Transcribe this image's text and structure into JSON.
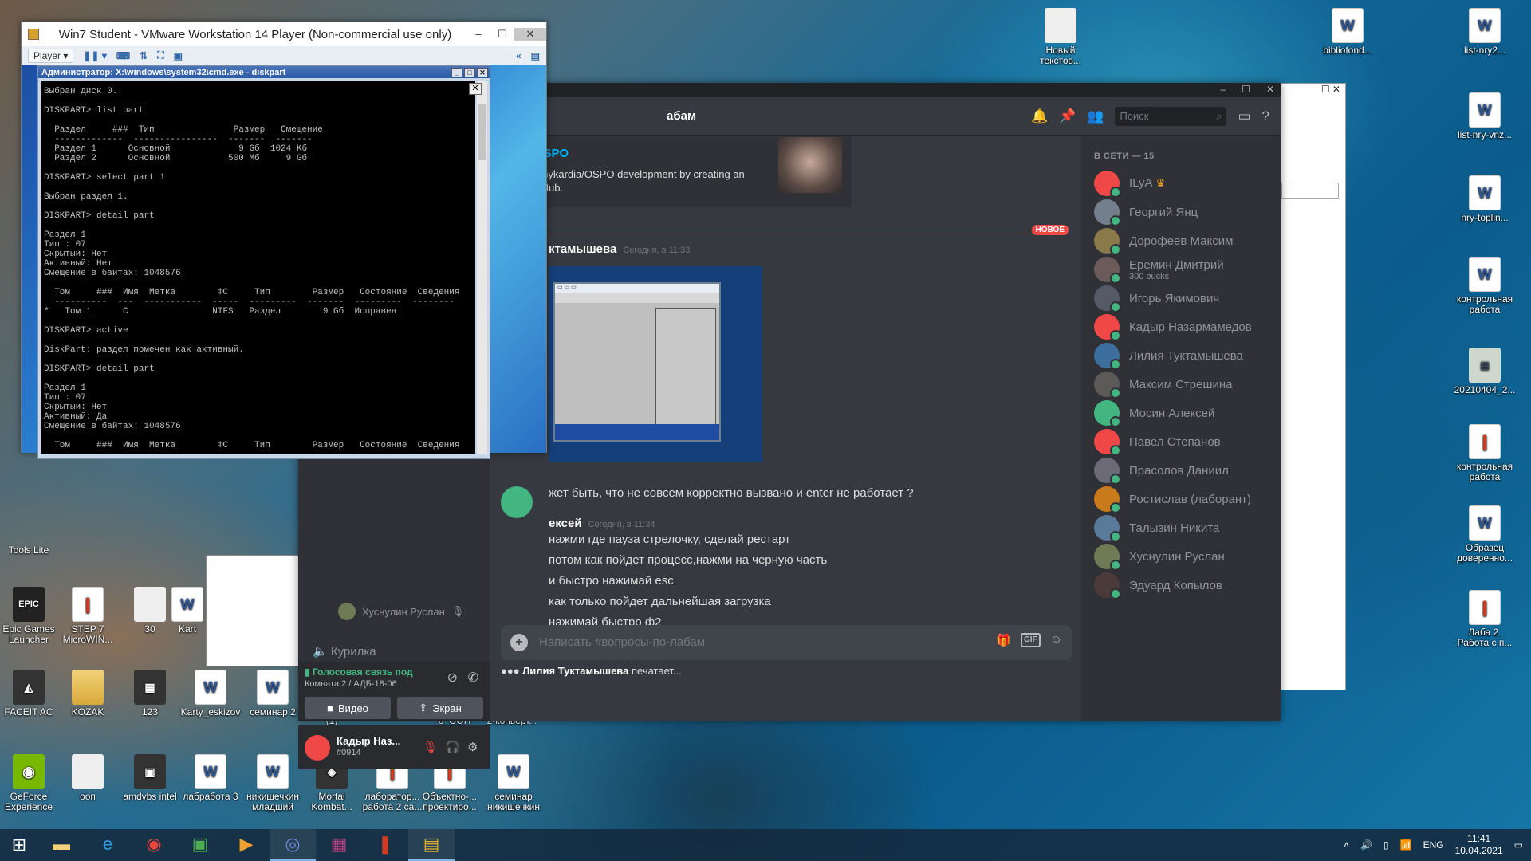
{
  "desktop_icons": [
    {
      "label": "bibliofond..."
    },
    {
      "label": "list-nry2..."
    },
    {
      "label": "Новый текстов..."
    },
    {
      "label": "list-nry-vnz..."
    },
    {
      "label": "nry-toplin..."
    },
    {
      "label": "контрольная работа"
    },
    {
      "label": "20210404_2..."
    },
    {
      "label": "контрольная работа"
    },
    {
      "label": "Образец доверенно..."
    },
    {
      "label": "Лаба 2. Работа с п..."
    },
    {
      "label": "Epic Games Launcher"
    },
    {
      "label": "STEP 7 MicroWIN..."
    },
    {
      "label": "30"
    },
    {
      "label": "Kart"
    },
    {
      "label": "FACEIT AC"
    },
    {
      "label": "KOZAK"
    },
    {
      "label": "123"
    },
    {
      "label": "Karty_eskizov"
    },
    {
      "label": "семинар 2"
    },
    {
      "label": "(1)"
    },
    {
      "label": "6_ООП"
    },
    {
      "label": "2-конверт..."
    },
    {
      "label": "GeForce Experience"
    },
    {
      "label": "ooп"
    },
    {
      "label": "amdvbs intel"
    },
    {
      "label": "лабработа 3"
    },
    {
      "label": "никишечкин младший"
    },
    {
      "label": "Mortal Kombat..."
    },
    {
      "label": "лаборатор... работа 2 са..."
    },
    {
      "label": "Объектно-... проектиро..."
    },
    {
      "label": "семинар никишечкин"
    },
    {
      "label": "Tools Lite"
    }
  ],
  "vmware": {
    "title": "Win7 Student - VMware Workstation 14 Player (Non-commercial use only)",
    "player_menu": "Player ▾",
    "controls": {
      "min": "–",
      "max": "☐",
      "close": "✕"
    }
  },
  "cmd": {
    "title": "Администратор: X:\\windows\\system32\\cmd.exe - diskpart",
    "lines": [
      "Выбран диск 0.",
      "",
      "DISKPART> list part",
      "",
      "  Раздел     ###  Тип               Размер   Смещение",
      "  -------------  ----------------  -------  -------",
      "  Раздел 1      Основной             9 Gб  1024 Kб",
      "  Раздел 2      Основной           500 Mб     9 Gб",
      "",
      "DISKPART> select part 1",
      "",
      "Выбран раздел 1.",
      "",
      "DISKPART> detail part",
      "",
      "Раздел 1",
      "Тип : 07",
      "Скрытый: Нет",
      "Активный: Нет",
      "Смещение в байтах: 1048576",
      "",
      "  Том     ###  Имя  Метка        ФС     Тип        Размер   Состояние  Сведения",
      "  ----------  ---  -----------  -----  ---------  -------  ---------  --------",
      "*   Том 1      C                NTFS   Раздел        9 Gб  Исправен",
      "",
      "DISKPART> active",
      "",
      "DiskPart: раздел помечен как активный.",
      "",
      "DISKPART> detail part",
      "",
      "Раздел 1",
      "Тип : 07",
      "Скрытый: Нет",
      "Активный: Да",
      "Смещение в байтах: 1048576",
      "",
      "  Том     ###  Имя  Метка        ФС     Тип        Размер   Состояние  Сведения",
      "  ----------  ---  -----------  -----  ---------  -------  ---------  --------",
      "*   Том 1      C                NTFS   Раздел        9 Gб  Исправен",
      "",
      "DISKPART>"
    ]
  },
  "discord": {
    "channel_name": "абам",
    "search_placeholder": "Поиск",
    "embed": {
      "link": "dia/OSPO",
      "desc": "e to tahykardia/OSPO development by creating an on GitHub."
    },
    "new_tag": "НОВОЕ",
    "msg1": {
      "author": "ктамышева",
      "time": "Сегодня, в 11:33"
    },
    "msg1_text": "жет быть, что не совсем корректно вызвано и enter не работает ?",
    "msg2": {
      "author": "ексей",
      "time": "Сегодня, в 11:34"
    },
    "msg2_lines": [
      "нажми где пауза стрелочку, сделай рестарт",
      "потом как пойдет процесс,нажми на черную часть",
      "и быстро нажимай esc",
      "как только пойдет дальнейшая загрузка",
      "нажимай быстро ф2"
    ],
    "input_placeholder": "Написать #вопросы-по-лабам",
    "typing_user": "Лилия Туктамышева",
    "typing_suffix": " печатает...",
    "voice_user": "Хуснулин Руслан",
    "channel_kurilka": "Курилка",
    "voice_status": "Голосовая связь под",
    "voice_room": "Комната 2 / АДБ-18-06",
    "btn_video": "Видео",
    "btn_screen": "Экран",
    "me": {
      "name": "Кадыр Наз...",
      "tag": "#0914"
    },
    "members_header": "В СЕТИ — 15",
    "members": [
      {
        "name": "ILyA",
        "sub": "",
        "color": "#f04747"
      },
      {
        "name": "Георгий Янц",
        "sub": "",
        "color": "#747f8d"
      },
      {
        "name": "Дорофеев Максим",
        "sub": "",
        "color": "#8a7a4a"
      },
      {
        "name": "Еремин Дмитрий",
        "sub": "300 bucks",
        "color": "#6b5a5a"
      },
      {
        "name": "Игорь Якимович",
        "sub": "",
        "color": "#555a66"
      },
      {
        "name": "Кадыр Назармамедов",
        "sub": "",
        "color": "#f04747"
      },
      {
        "name": "Лилия Туктамышева",
        "sub": "",
        "color": "#3d6f9e"
      },
      {
        "name": "Максим Стрешина",
        "sub": "",
        "color": "#5c5a58"
      },
      {
        "name": "Мосин Алексей",
        "sub": "",
        "color": "#43b581"
      },
      {
        "name": "Павел Степанов",
        "sub": "",
        "color": "#f04747"
      },
      {
        "name": "Прасолов Даниил",
        "sub": "",
        "color": "#6d6a78"
      },
      {
        "name": "Ростислав (лаборант)",
        "sub": "",
        "color": "#c97a1a"
      },
      {
        "name": "Талызин Никита",
        "sub": "",
        "color": "#5a7a9a"
      },
      {
        "name": "Хуснулин Руслан",
        "sub": "",
        "color": "#6e7b55"
      },
      {
        "name": "Эдуард Копылов",
        "sub": "",
        "color": "#4a3a3a"
      }
    ]
  },
  "taskbar": {
    "lang": "ENG",
    "time": "11:41",
    "date": "10.04.2021"
  }
}
